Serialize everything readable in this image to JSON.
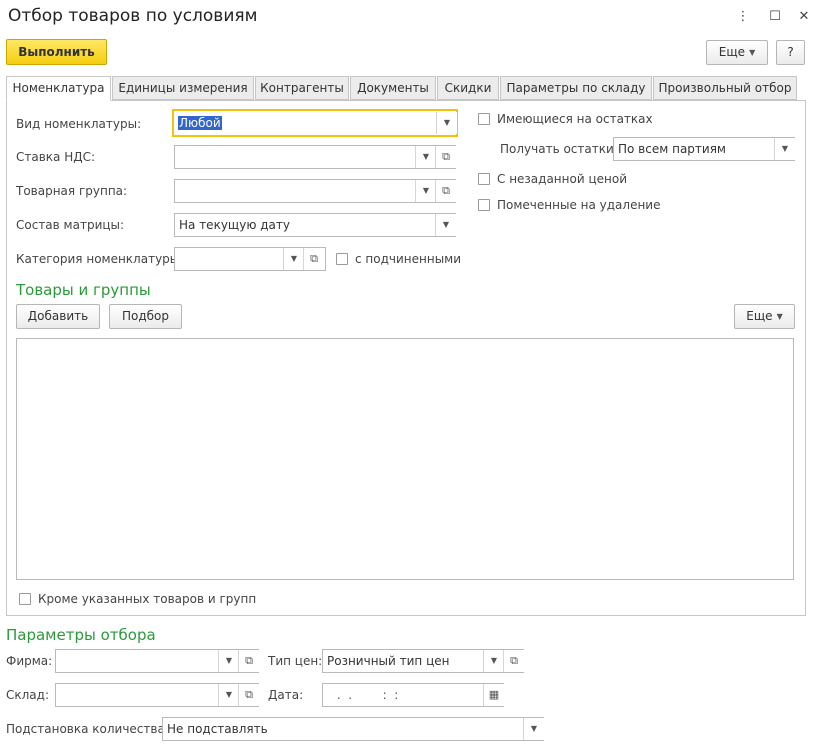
{
  "window": {
    "title": "Отбор товаров по условиям",
    "menu_icon": "⋮",
    "maximize_icon": "☐",
    "close_icon": "✕"
  },
  "toolbar": {
    "execute_label": "Выполнить",
    "more_label": "Еще",
    "help_label": "?"
  },
  "tabs": [
    {
      "label": "Номенклатура",
      "active": true
    },
    {
      "label": "Единицы измерения"
    },
    {
      "label": "Контрагенты"
    },
    {
      "label": "Документы"
    },
    {
      "label": "Скидки"
    },
    {
      "label": "Параметры по складу"
    },
    {
      "label": "Произвольный отбор"
    }
  ],
  "nomenclature": {
    "kind_label": "Вид номенклатуры:",
    "kind_value": "Любой",
    "vat_label": "Ставка НДС:",
    "vat_value": "",
    "group_label": "Товарная группа:",
    "group_value": "",
    "matrix_label": "Состав матрицы:",
    "matrix_value": "На текущую дату",
    "category_label": "Категория номенклатуры:",
    "category_value": "",
    "subordinate_label": "с подчиненными",
    "subordinate_checked": false
  },
  "right_options": {
    "in_stock_label": "Имеющиеся на остатках",
    "in_stock_checked": false,
    "get_balances_label": "Получать остатки:",
    "get_balances_value": "По всем партиям",
    "no_price_label": "С незаданной ценой",
    "no_price_checked": false,
    "marked_deleted_label": "Помеченные на удаление",
    "marked_deleted_checked": false
  },
  "goods": {
    "section_title": "Товары и группы",
    "add_label": "Добавить",
    "pick_label": "Подбор",
    "more_label": "Еще",
    "except_label": "Кроме указанных товаров и групп",
    "except_checked": false
  },
  "params": {
    "section_title": "Параметры отбора",
    "firm_label": "Фирма:",
    "firm_value": "",
    "price_type_label": "Тип цен:",
    "price_type_value": "Розничный тип цен",
    "warehouse_label": "Склад:",
    "warehouse_value": "",
    "date_label": "Дата:",
    "date_value": " .  .        :  :",
    "quantity_label": "Подстановка количества:",
    "quantity_value": "Не подставлять"
  },
  "icons": {
    "dropdown": "▼",
    "open": "⧉",
    "calendar": "▦"
  }
}
